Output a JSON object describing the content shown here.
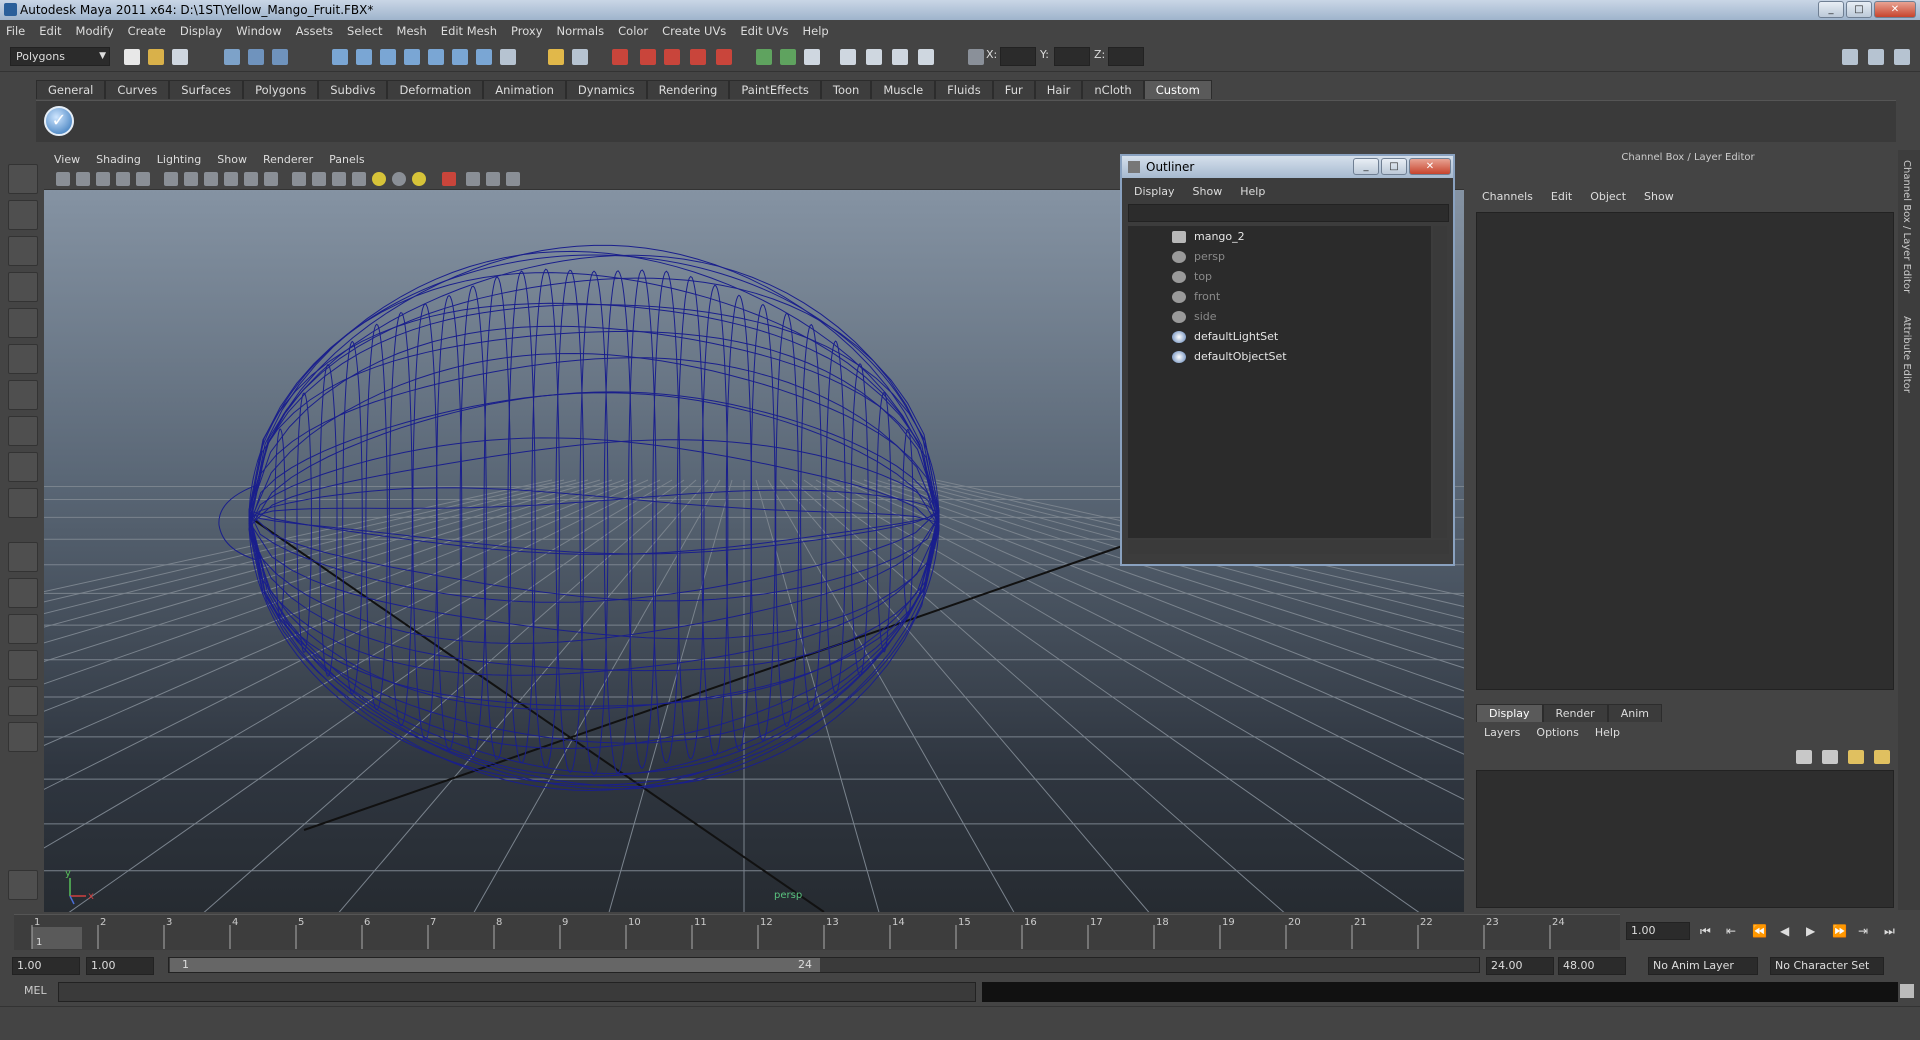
{
  "window": {
    "title": "Autodesk Maya 2011 x64: D:\\1ST\\Yellow_Mango_Fruit.FBX*",
    "min": "_",
    "max": "□",
    "close": "✕"
  },
  "menubar": [
    "File",
    "Edit",
    "Modify",
    "Create",
    "Display",
    "Window",
    "Assets",
    "Select",
    "Mesh",
    "Edit Mesh",
    "Proxy",
    "Normals",
    "Color",
    "Create UVs",
    "Edit UVs",
    "Help"
  ],
  "statusline": {
    "mode": "Polygons",
    "x_label": "X:",
    "y_label": "Y:",
    "z_label": "Z:"
  },
  "shelf": {
    "tabs": [
      "General",
      "Curves",
      "Surfaces",
      "Polygons",
      "Subdivs",
      "Deformation",
      "Animation",
      "Dynamics",
      "Rendering",
      "PaintEffects",
      "Toon",
      "Muscle",
      "Fluids",
      "Fur",
      "Hair",
      "nCloth",
      "Custom"
    ],
    "active": "Custom"
  },
  "viewport": {
    "menu": [
      "View",
      "Shading",
      "Lighting",
      "Show",
      "Renderer",
      "Panels"
    ],
    "camera_label": "persp",
    "axis_x": "x",
    "axis_y": "y",
    "wire_color": "#1a1f8c"
  },
  "outliner": {
    "title": "Outliner",
    "menu": [
      "Display",
      "Show",
      "Help"
    ],
    "items": [
      {
        "label": "mango_2",
        "icon": "mesh-transform-icon",
        "dim": false
      },
      {
        "label": "persp",
        "icon": "camera-icon",
        "dim": true
      },
      {
        "label": "top",
        "icon": "camera-icon",
        "dim": true
      },
      {
        "label": "front",
        "icon": "camera-icon",
        "dim": true
      },
      {
        "label": "side",
        "icon": "camera-icon",
        "dim": true
      },
      {
        "label": "defaultLightSet",
        "icon": "set-icon",
        "dim": false
      },
      {
        "label": "defaultObjectSet",
        "icon": "set-icon",
        "dim": false
      }
    ]
  },
  "channelbox": {
    "title": "Channel Box / Layer Editor",
    "menu": [
      "Channels",
      "Edit",
      "Object",
      "Show"
    ],
    "layer_tabs": [
      "Display",
      "Render",
      "Anim"
    ],
    "layer_menu": [
      "Layers",
      "Options",
      "Help"
    ]
  },
  "side_tabs": [
    "Channel Box / Layer Editor",
    "Attribute Editor"
  ],
  "timeline": {
    "frames": [
      "1",
      "2",
      "3",
      "4",
      "5",
      "6",
      "7",
      "8",
      "9",
      "10",
      "11",
      "12",
      "13",
      "14",
      "15",
      "16",
      "17",
      "18",
      "19",
      "20",
      "21",
      "22",
      "23",
      "24"
    ],
    "current_frame": "1.00",
    "playhead_label": "1"
  },
  "range": {
    "start_time": "1.00",
    "playback_start": "1.00",
    "range_start_label": "1",
    "range_end_label": "24",
    "playback_end": "24.00",
    "end_time": "48.00",
    "anim_layer": "No Anim Layer",
    "character_set": "No Character Set"
  },
  "commandline": {
    "label": "MEL"
  }
}
